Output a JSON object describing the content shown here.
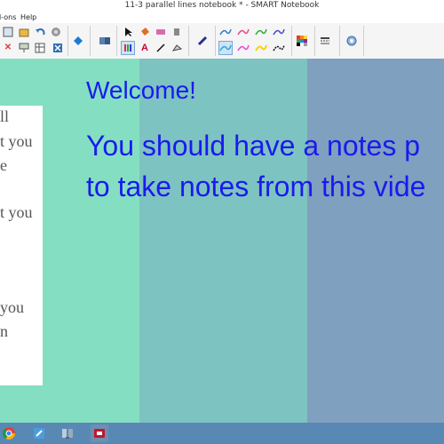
{
  "window": {
    "title": "11-3 parallel lines notebook * - SMART Notebook"
  },
  "menu": {
    "items": [
      "l-ons",
      "Help"
    ]
  },
  "toolbar": {
    "tools": [
      "new-page",
      "open-file",
      "undo",
      "redo",
      "delete",
      "screen-shade",
      "table",
      "fullscreen",
      "add-ons",
      "lesson-activity",
      "select",
      "fill",
      "eraser",
      "magic-pen",
      "pen",
      "text",
      "line",
      "shapes",
      "pen-style",
      "pen-color",
      "line-style",
      "properties"
    ],
    "pen_swatches": [
      "#2a7fd4",
      "#e64a8c",
      "#29b02e",
      "#4a4ad0",
      "#22aadd",
      "#e64ad6",
      "#ffd000",
      "#111111"
    ],
    "palette_colors": [
      "#e53935",
      "#fb8c00",
      "#fdd835",
      "#43a047",
      "#1e88e5",
      "#8e24aa",
      "#000000",
      "#ffffff",
      "#9e9e9e"
    ]
  },
  "slide": {
    "welcome": "Welcome!",
    "line1": "You should have a notes p",
    "line2": "to take notes from this vide",
    "background_colors": [
      "#84dfc2",
      "#7dc3c1",
      "#7fa0bf"
    ],
    "text_color": "#1a1aee"
  },
  "notes_paper": {
    "lines": [
      "ll",
      "t you",
      "e",
      "t you",
      "you",
      "n"
    ]
  },
  "taskbar": {
    "apps": [
      "chrome",
      "notepad",
      "network-app",
      "smart-notebook"
    ]
  }
}
